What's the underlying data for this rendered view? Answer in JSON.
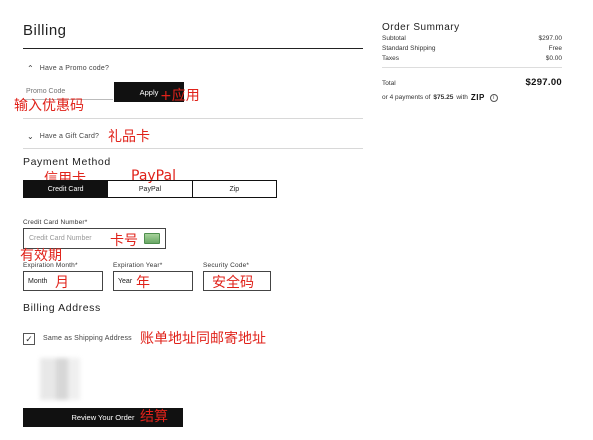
{
  "billing": {
    "title": "Billing",
    "promo_toggle": "Have a Promo code?",
    "promo_placeholder": "Promo Code",
    "apply_label": "Apply",
    "gift_toggle": "Have a Gift Card?",
    "payment_method_title": "Payment Method",
    "payment_tabs": [
      {
        "label": "Credit Card",
        "active": true
      },
      {
        "label": "PayPal",
        "active": false
      },
      {
        "label": "Zip",
        "active": false
      }
    ],
    "card_number_label": "Credit Card Number*",
    "card_number_placeholder": "Credit Card Number",
    "exp_month_label": "Expiration Month*",
    "exp_month_value": "Month",
    "exp_year_label": "Expiration Year*",
    "exp_year_value": "Year",
    "security_code_label": "Security Code*",
    "billing_address_title": "Billing Address",
    "same_as_shipping_label": "Same as Shipping Address",
    "same_as_shipping_checked": true,
    "review_button": "Review Your Order"
  },
  "annotations": {
    "apply": "+应用",
    "promo": "输入优惠码",
    "gift": "礼品卡",
    "credit": "信用卡",
    "paypal": "PayPal",
    "card_number": "卡号",
    "expiry": "有效期",
    "month": "月",
    "year": "年",
    "security": "安全码",
    "address": "账单地址同邮寄地址",
    "review": "结算"
  },
  "order_summary": {
    "title": "Order Summary",
    "rows": [
      {
        "label": "Subtotal",
        "value": "$297.00"
      },
      {
        "label": "Standard Shipping",
        "value": "Free"
      },
      {
        "label": "Taxes",
        "value": "$0.00"
      }
    ],
    "total_label": "Total",
    "total_value": "$297.00",
    "installments_text": "or 4 payments of",
    "installment_amount": "$75.25",
    "with_text": "with",
    "zip_logo": "ZIP"
  },
  "icons": {
    "promo_chevron": "chevron-up-icon",
    "gift_chevron": "chevron-down-icon",
    "card": "credit-card-icon",
    "check": "checkmark-icon",
    "info": "info-icon"
  },
  "colors": {
    "primary": "#111111",
    "annotation": "#e0221a",
    "card_icon": "#6aa866"
  }
}
